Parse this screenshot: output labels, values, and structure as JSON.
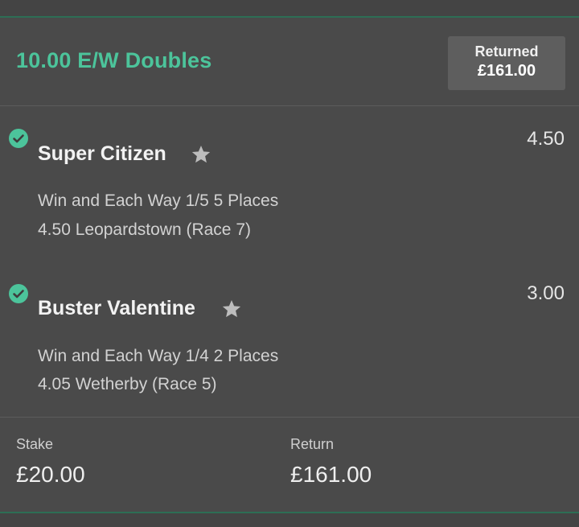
{
  "bet": {
    "title": "10.00 E/W Doubles",
    "returned_label": "Returned",
    "returned_value": "£161.00",
    "accent_color": "#4cc49b"
  },
  "selections": [
    {
      "name": "Super Citizen",
      "odds": "4.50",
      "market": "Win and Each Way 1/5 5 Places",
      "event": "4.50 Leopardstown (Race 7)",
      "status_icon": "check-circle-icon",
      "favourite_icon": "star-icon"
    },
    {
      "name": "Buster Valentine",
      "odds": "3.00",
      "market": "Win and Each Way 1/4 2 Places",
      "event": "4.05 Wetherby (Race 5)",
      "status_icon": "check-circle-icon",
      "favourite_icon": "star-icon"
    }
  ],
  "footer": {
    "stake_label": "Stake",
    "stake_value": "£20.00",
    "return_label": "Return",
    "return_value": "£161.00"
  }
}
